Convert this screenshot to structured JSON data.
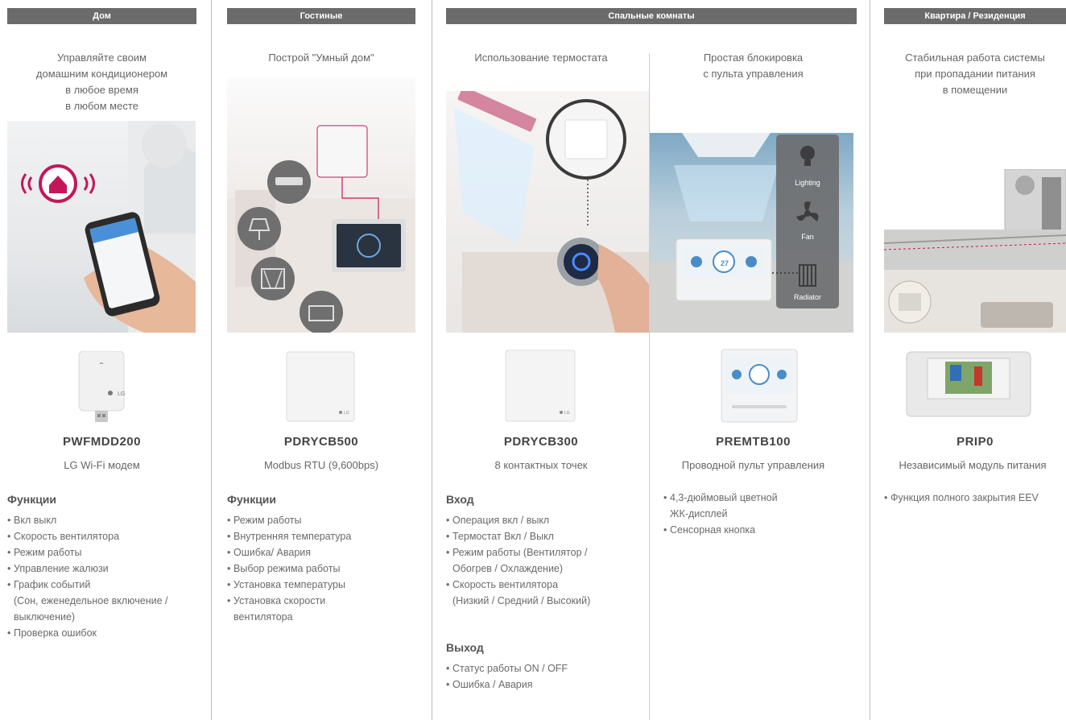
{
  "columns": {
    "home": {
      "header": "Дом",
      "intro": "Управляйте своим\nдомашним кондиционером\nв любое время\nв любом месте",
      "product_code": "PWFMDD200",
      "product_desc": "LG Wi-Fi модем",
      "features_title": "Функции",
      "features": [
        "Вкл выкл",
        "Скорость вентилятора",
        "Режим работы",
        "Управление жалюзи",
        "График событий\n(Сон, еженедельное включение /\nвыключение)",
        "Проверка ошибок"
      ]
    },
    "living": {
      "header": "Гостиные",
      "intro": "Построй \"Умный дом\"",
      "product_code": "PDRYCB500",
      "product_desc": "Modbus RTU (9,600bps)",
      "features_title": "Функции",
      "features": [
        "Режим работы",
        "Внутренняя температура",
        "Ошибка/ Авария",
        "Выбор  режима работы",
        "Установка температуры",
        "Установка скорости\nвентилятора"
      ]
    },
    "bedrooms": {
      "header": "Спальные комнаты",
      "thermostat": {
        "intro": "Использование термостата",
        "product_code": "PDRYCB300",
        "product_desc": "8 контактных точек",
        "input_title": "Вход",
        "input_items": [
          "Операция вкл / выкл",
          "Термостат  Вкл / Выкл",
          "Режим работы (Вентилятор /\nОбогрев / Охлаждение)",
          "Скорость вентилятора\n(Низкий / Средний / Высокий)"
        ],
        "output_title": "Выход",
        "output_items": [
          "Статус работы ON / OFF",
          "Ошибка / Авария"
        ]
      },
      "lock": {
        "intro": "Простая блокировка\nс пульта управления",
        "product_code": "PREMTB100",
        "product_desc": "Проводной пульт управления",
        "features": [
          "4,3-дюймовый цветной\nЖК-дисплей",
          "Сенсорная кнопка"
        ],
        "device_labels": [
          "Lighting",
          "Fan",
          "Radiator"
        ],
        "screen_temp": "27"
      }
    },
    "apartment": {
      "header": "Квартира / Резиденция",
      "intro": "Стабильная работа системы\nпри пропадании питания\nв помещении",
      "product_code": "PRIP0",
      "product_desc": "Независимый модуль питания",
      "features": [
        "Функция полного закрытия EEV"
      ]
    }
  },
  "colors": {
    "header_bg": "#6b6b6b",
    "accent_red": "#c2185b",
    "text": "#666666"
  }
}
